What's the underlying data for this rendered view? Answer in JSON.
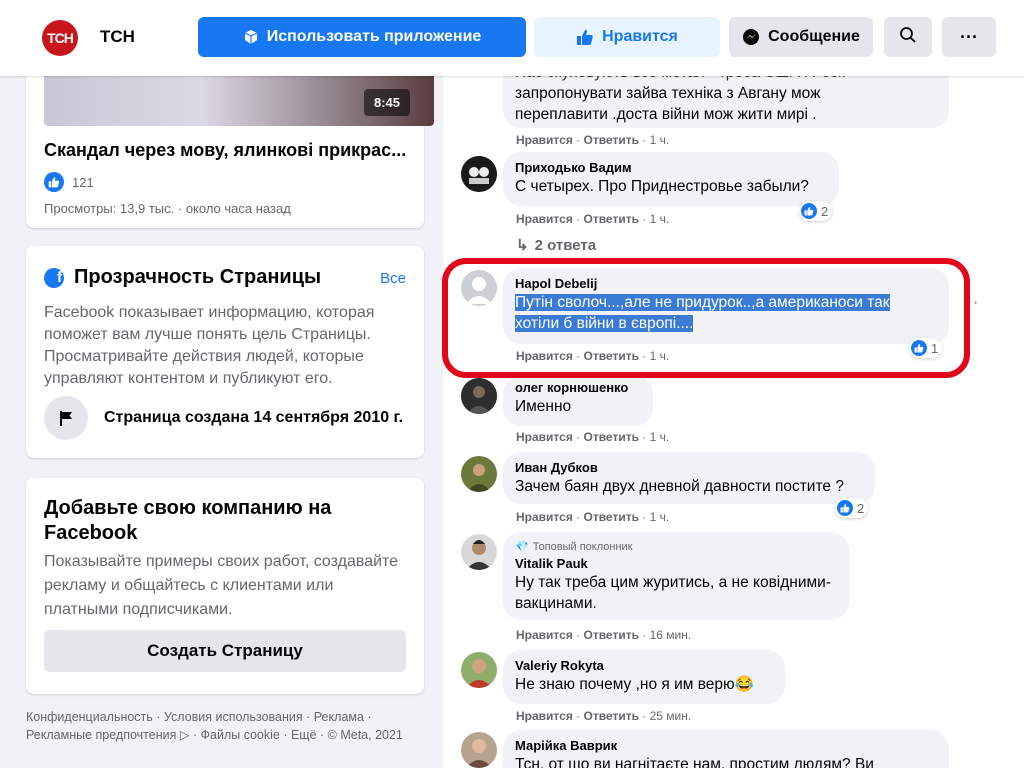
{
  "header": {
    "logo_text": "ТСН",
    "page_name": "ТСН",
    "use_app_label": "Использовать приложение",
    "like_label": "Нравится",
    "message_label": "Сообщение",
    "more_label": "···"
  },
  "video": {
    "duration": "8:45",
    "title": "Скандал через мову, ялинкові прикрас...",
    "likes": "121",
    "meta": "Просмотры: 13,9 тыс. · около часа назад"
  },
  "transparency": {
    "title": "Прозрачность Страницы",
    "all_link": "Все",
    "text": "Facebook показывает информацию, которая поможет вам лучше понять цель Страницы. Просматривайте действия людей, которые управляют контентом и публикуют его.",
    "created": "Страница создана 14 сентября 2010 г."
  },
  "business": {
    "title": "Добавьте свою компанию на Facebook",
    "text": "Показывайте примеры своих работ, создавайте рекламу и общайтесь с клиентами или платными подписчиками.",
    "button": "Создать Страницу"
  },
  "footer": {
    "text": "Конфиденциальность · Условия использования · Реклама · Рекламные предпочтения ▷ · Файлы cookie · Ещё · © Meta, 2021"
  },
  "comments": [
    {
      "author": "",
      "lines": [
        "Нас скуповують все метал - треба США і Росії",
        "запропонувати зайва техніка з Авгану мож",
        "переплавити .доста війни мож жити мирі ."
      ],
      "actions": {
        "like": "Нравится",
        "reply": "Ответить",
        "time": "1 ч."
      }
    },
    {
      "author": "Приходько Вадим",
      "lines": [
        "С четырех. Про Приднестровье забыли?"
      ],
      "reactions": "2",
      "actions": {
        "like": "Нравится",
        "reply": "Ответить",
        "time": "1 ч."
      },
      "replies": "2 ответа"
    },
    {
      "author": "Hapol Debelij",
      "lines": [
        "Путін сволоч...,але не придурок..,а американоси так",
        "хотіли б війни в європі...."
      ],
      "reactions": "1",
      "actions": {
        "like": "Нравится",
        "reply": "Ответить",
        "time": "1 ч."
      }
    },
    {
      "author": "олег корнюшенко",
      "lines": [
        "Именно"
      ],
      "actions": {
        "like": "Нравится",
        "reply": "Ответить",
        "time": "1 ч."
      }
    },
    {
      "author": "Иван Дубков",
      "lines": [
        "Зачем баян двух дневной давности постите ?"
      ],
      "reactions": "2",
      "actions": {
        "like": "Нравится",
        "reply": "Ответить",
        "time": "1 ч."
      }
    },
    {
      "badge": "Топовый поклонник",
      "author": "Vitalik Pauk",
      "lines": [
        "Ну так треба цим журитись, а не ковідними-",
        "вакцинами."
      ],
      "actions": {
        "like": "Нравится",
        "reply": "Ответить",
        "time": "16 мин."
      }
    },
    {
      "author": "Valeriy Rokyta",
      "lines": [
        "Не знаю почему ,но я им верю😂"
      ],
      "actions": {
        "like": "Нравится",
        "reply": "Ответить",
        "time": "25 мин."
      }
    },
    {
      "author": "Марійка Ваврик",
      "lines": [
        "Тсн, от що ви нагнітаєте нам, простим людям? Ви"
      ],
      "actions": {}
    }
  ],
  "colors": {
    "accent": "#1877f2",
    "highlight": "#3a7bd5",
    "annotation": "#e1061a"
  }
}
